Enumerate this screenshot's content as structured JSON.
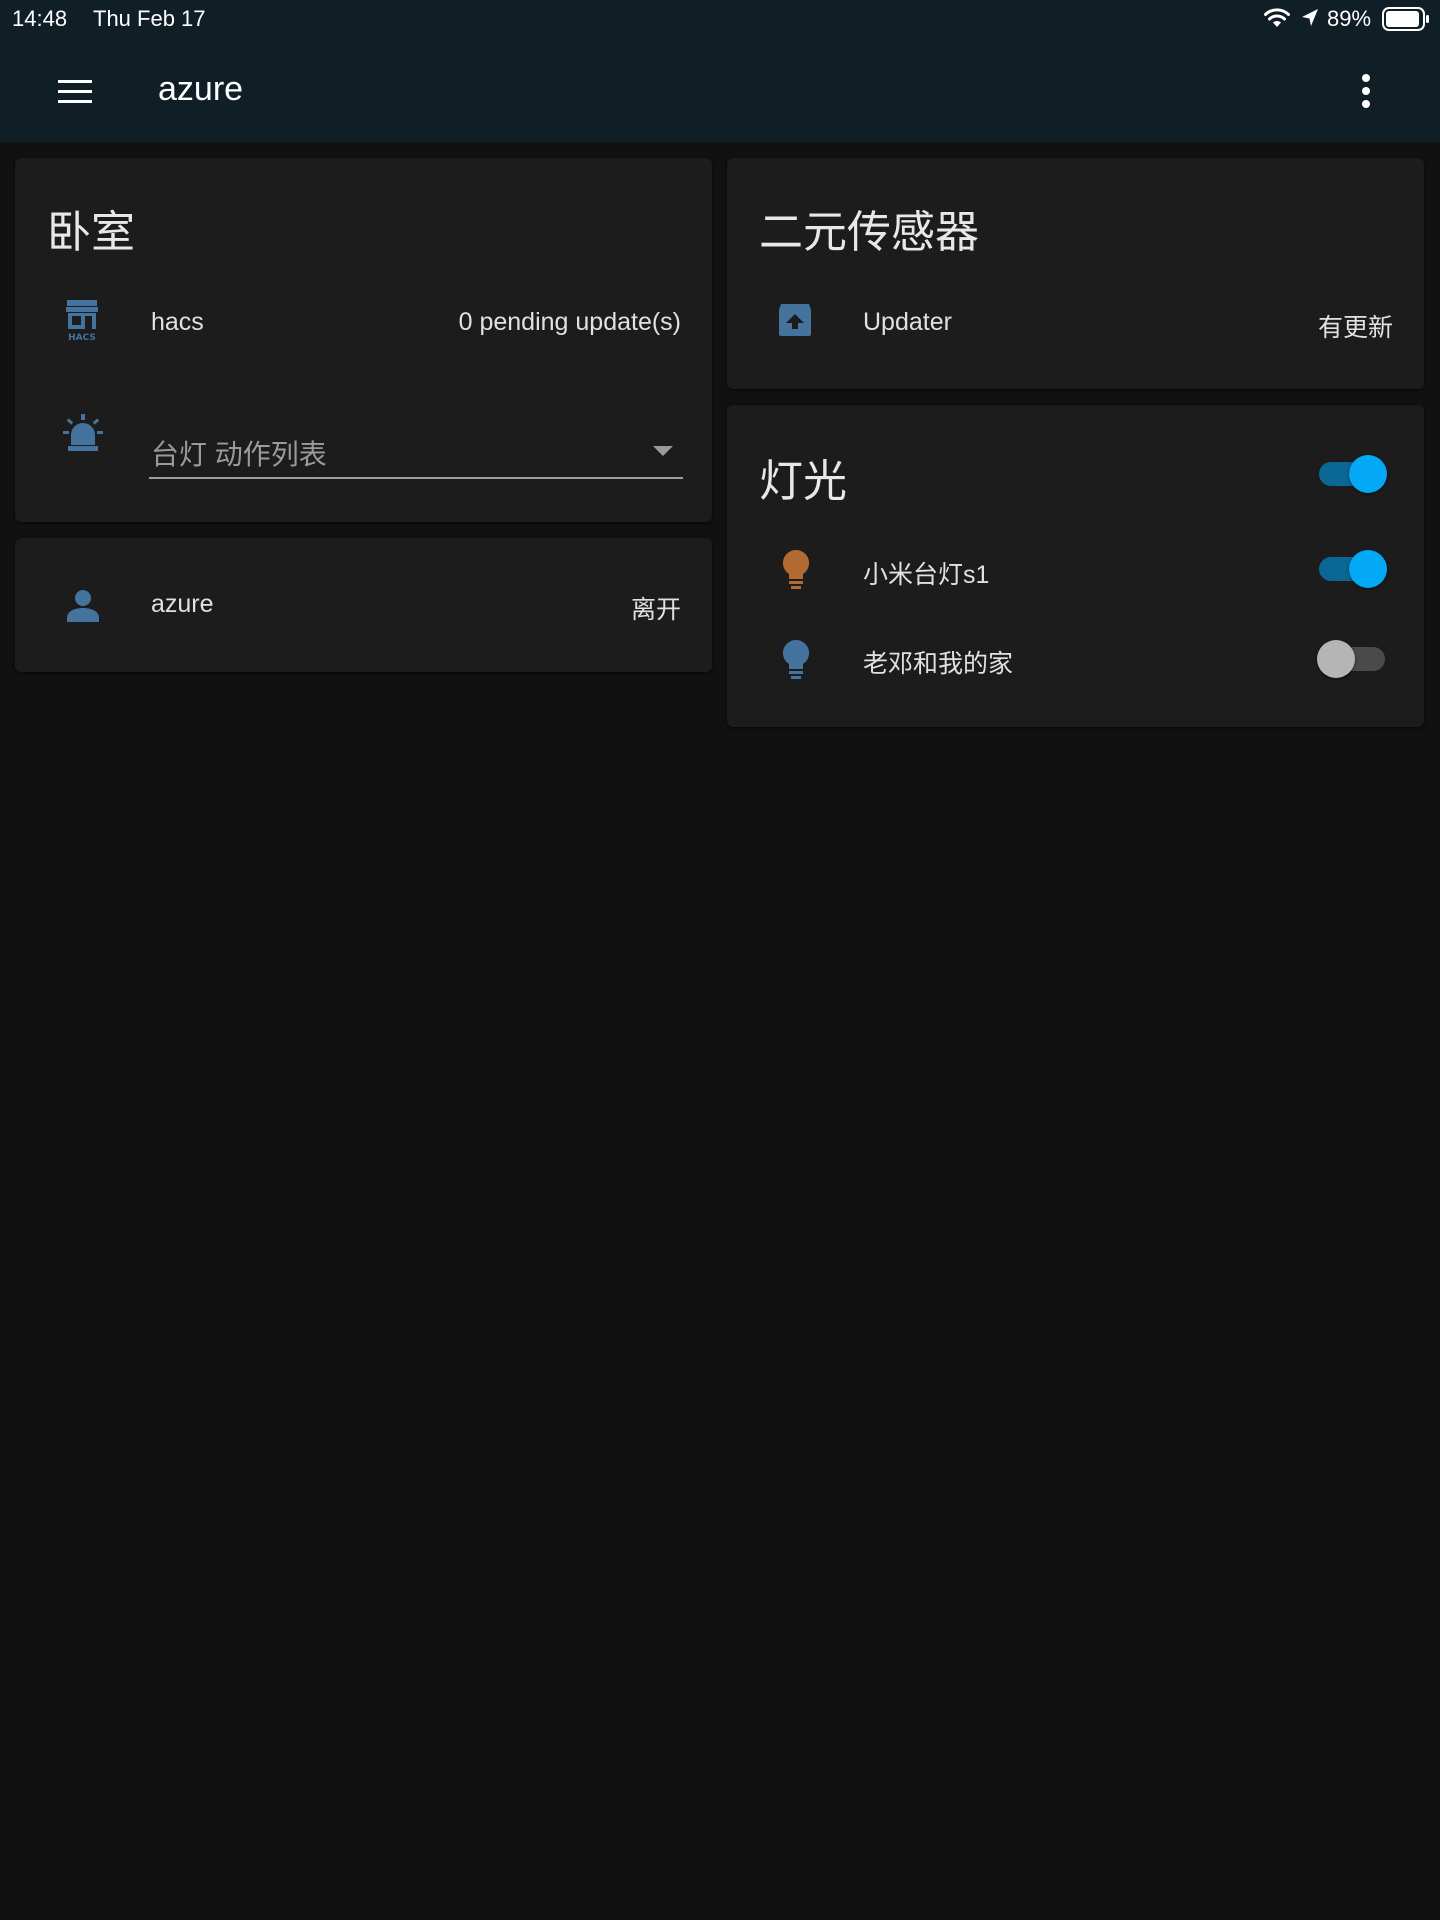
{
  "statusbar": {
    "time": "14:48",
    "date": "Thu Feb 17",
    "battery": "89%"
  },
  "appbar": {
    "title": "azure",
    "menu_icon": "menu-icon",
    "more_icon": "more-vertical-icon"
  },
  "bedroom_card": {
    "title": "卧室",
    "hacs": {
      "icon": "hacs-icon",
      "name": "hacs",
      "state": "0 pending update(s)"
    },
    "select": {
      "icon": "alarm-light-icon",
      "label": "台灯 动作列表"
    }
  },
  "person_card": {
    "icon": "account-icon",
    "name": "azure",
    "state": "离开"
  },
  "binary_sensor_card": {
    "title": "二元传感器",
    "updater": {
      "icon": "package-up-icon",
      "name": "Updater",
      "state": "有更新"
    }
  },
  "lights_card": {
    "title": "灯光",
    "header_toggle_on": true,
    "items": [
      {
        "icon": "lightbulb-icon",
        "name": "小米台灯s1",
        "on": true,
        "icon_color": "#b06a32"
      },
      {
        "icon": "lightbulb-icon",
        "name": "老邓和我的家",
        "on": false,
        "icon_color": "#44739e"
      }
    ]
  },
  "colors": {
    "background": "#111111",
    "card": "#1c1c1c",
    "header": "#101e26",
    "icon_default": "#44739e",
    "toggle_on": "#03a9f4"
  }
}
